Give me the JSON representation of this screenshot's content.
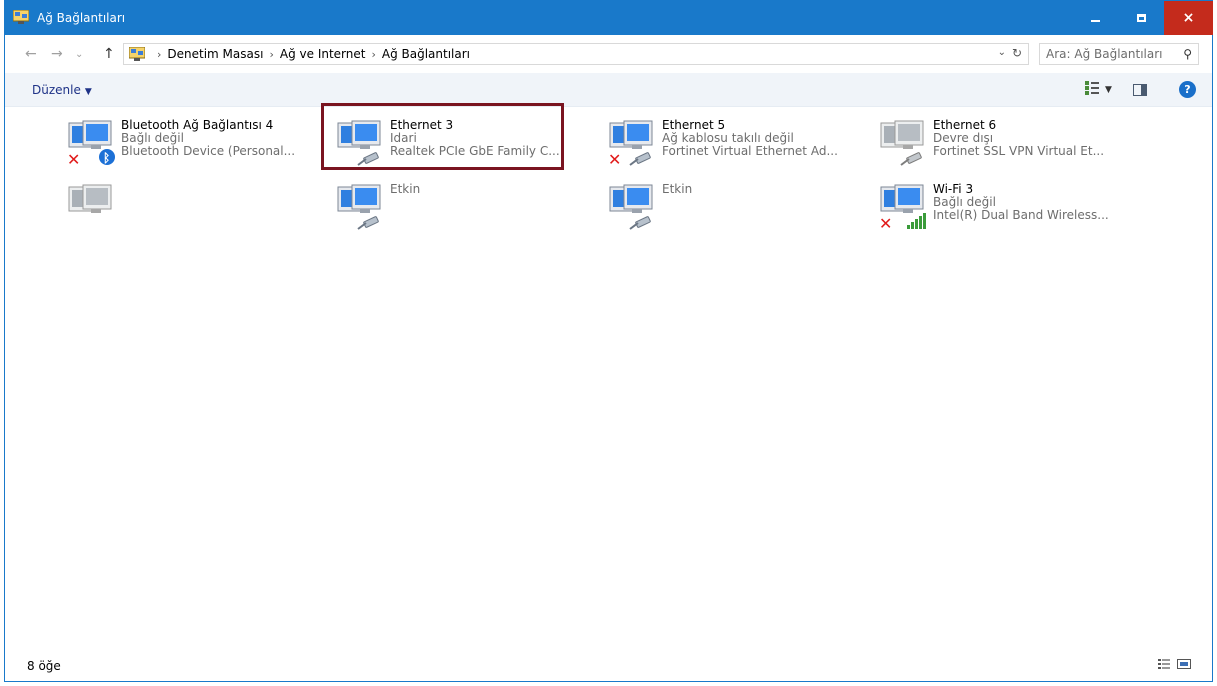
{
  "window": {
    "title": "Ağ Bağlantıları",
    "buttons": {
      "minimize": "minimize-icon",
      "maximize": "maximize-icon",
      "close": "×"
    }
  },
  "address": {
    "crumbs": [
      "Denetim Masası",
      "Ağ ve Internet",
      "Ağ Bağlantıları"
    ],
    "search_placeholder": "Ara: Ağ Bağlantıları"
  },
  "commandbar": {
    "organize_label": "Düzenle",
    "help_label": "?"
  },
  "items": [
    {
      "name": "Bluetooth Ağ Bağlantısı 4",
      "status": "Bağlı değil",
      "device": "Bluetooth Device (Personal...",
      "badge": "bluetooth",
      "error": true
    },
    {
      "name": "Ethernet 3",
      "status": "Idari",
      "device": "Realtek PCIe GbE Family C...",
      "badge": "cable",
      "error": false
    },
    {
      "name": "Ethernet 5",
      "status": "Ağ kablosu takılı değil",
      "device": "Fortinet Virtual Ethernet Ad...",
      "badge": "cable",
      "error": true
    },
    {
      "name": "Ethernet 6",
      "status": "Devre dışı",
      "device": "Fortinet SSL VPN Virtual Et...",
      "badge": "cable",
      "error": false
    },
    {
      "name": "",
      "status": "",
      "device": "",
      "badge": "none",
      "error": false
    },
    {
      "name": "",
      "status": "",
      "device": "Etkin",
      "badge": "cable",
      "error": false
    },
    {
      "name": "",
      "status": "",
      "device": "Etkin",
      "badge": "cable",
      "error": false
    },
    {
      "name": "Wi-Fi 3",
      "status": "Bağlı değil",
      "device": "Intel(R) Dual Band Wireless...",
      "badge": "wifi",
      "error": true
    }
  ],
  "status": {
    "count": "8 öğe"
  },
  "colors": {
    "titlebar": "#1979ca",
    "close": "#c42b1c",
    "selection_border": "#7a1420",
    "link": "#1e3287"
  }
}
